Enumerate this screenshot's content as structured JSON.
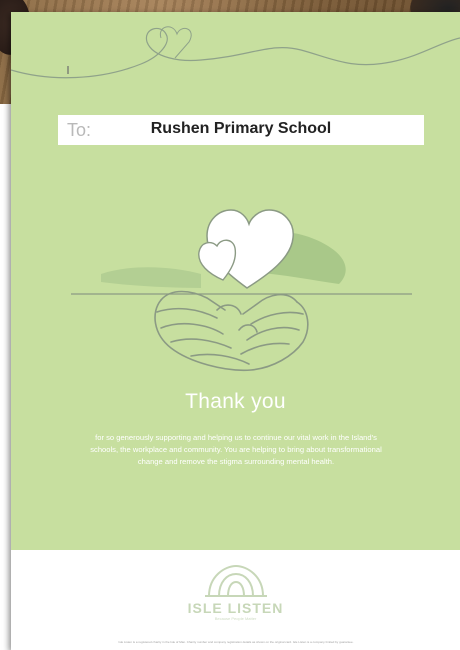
{
  "card": {
    "to_label": "To:",
    "recipient": "Rushen Primary School",
    "heading": "Thank you",
    "message": "for so generously supporting and helping us to continue our vital work in the Island's schools, the workplace and community. You are helping to bring about transformational change and remove the stigma surrounding mental health.",
    "brand": "ISLE LISTEN",
    "tagline": "Because People Matter",
    "fineprint": "Isle Listen is a registered charity in the Isle of Man. Charity number and company registration details as shown on the original card. Isle Listen is a company limited by guarantee."
  },
  "colors": {
    "card_green": "#c7df9f",
    "shadow_green": "#a9c889",
    "line_grey": "#8b9a84",
    "white": "#ffffff"
  },
  "icons": {
    "illustration": "hands-holding-hearts-icon",
    "logo": "isle-listen-arch-logo-icon"
  }
}
